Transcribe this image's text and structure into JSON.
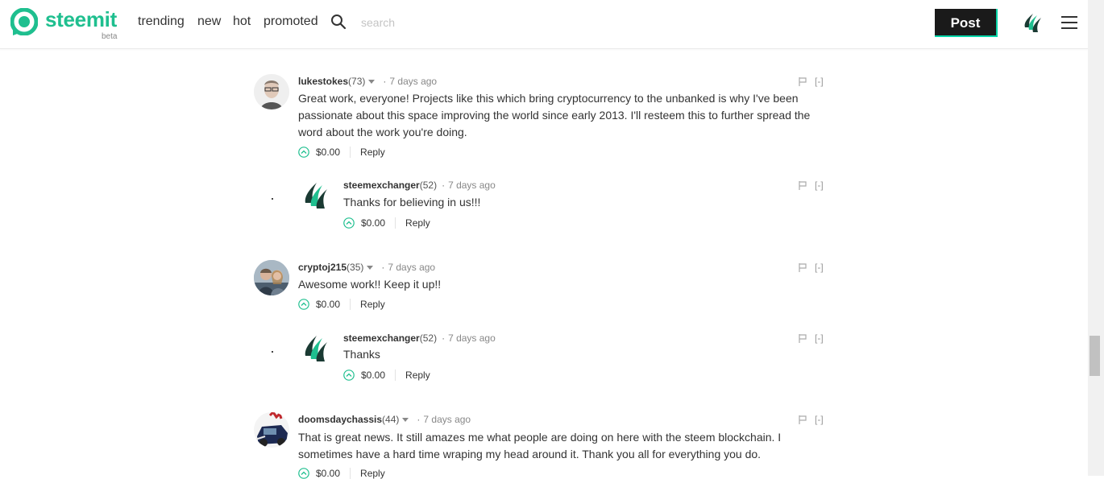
{
  "header": {
    "logo_text": "steemit",
    "logo_badge": "beta",
    "nav": [
      "trending",
      "new",
      "hot",
      "promoted"
    ],
    "search_placeholder": "search",
    "post_button": "Post",
    "brand_color": "#1fbf8f",
    "accent_color": "#06d6a9"
  },
  "comments": [
    {
      "author": "lukestokes",
      "reputation": "(73)",
      "time": "7 days ago",
      "body": "Great work, everyone! Projects like this which bring cryptocurrency to the unbanked is why I've been passionate about this space improving the world since early 2013. I'll resteem this to further spread the word about the work you're doing.",
      "payout": "$0.00",
      "reply_label": "Reply",
      "collapse_label": "[-]",
      "avatar": "person-photo"
    },
    {
      "author": "steemexchanger",
      "reputation": "(52)",
      "time": "7 days ago",
      "body": "Thanks for believing in us!!!",
      "payout": "$0.00",
      "reply_label": "Reply",
      "collapse_label": "[-]",
      "avatar": "steem-logo"
    },
    {
      "author": "cryptoj215",
      "reputation": "(35)",
      "time": "7 days ago",
      "body": "Awesome work!! Keep it up!!",
      "payout": "$0.00",
      "reply_label": "Reply",
      "collapse_label": "[-]",
      "avatar": "couple-photo"
    },
    {
      "author": "steemexchanger",
      "reputation": "(52)",
      "time": "7 days ago",
      "body": "Thanks",
      "payout": "$0.00",
      "reply_label": "Reply",
      "collapse_label": "[-]",
      "avatar": "steem-logo"
    },
    {
      "author": "doomsdaychassis",
      "reputation": "(44)",
      "time": "7 days ago",
      "body": "That is great news. It still amazes me what people are doing on here with the steem blockchain. I sometimes have a hard time wraping my head around it. Thank you all for everything you do.",
      "payout": "$0.00",
      "reply_label": "Reply",
      "collapse_label": "[-]",
      "avatar": "car-photo"
    }
  ]
}
